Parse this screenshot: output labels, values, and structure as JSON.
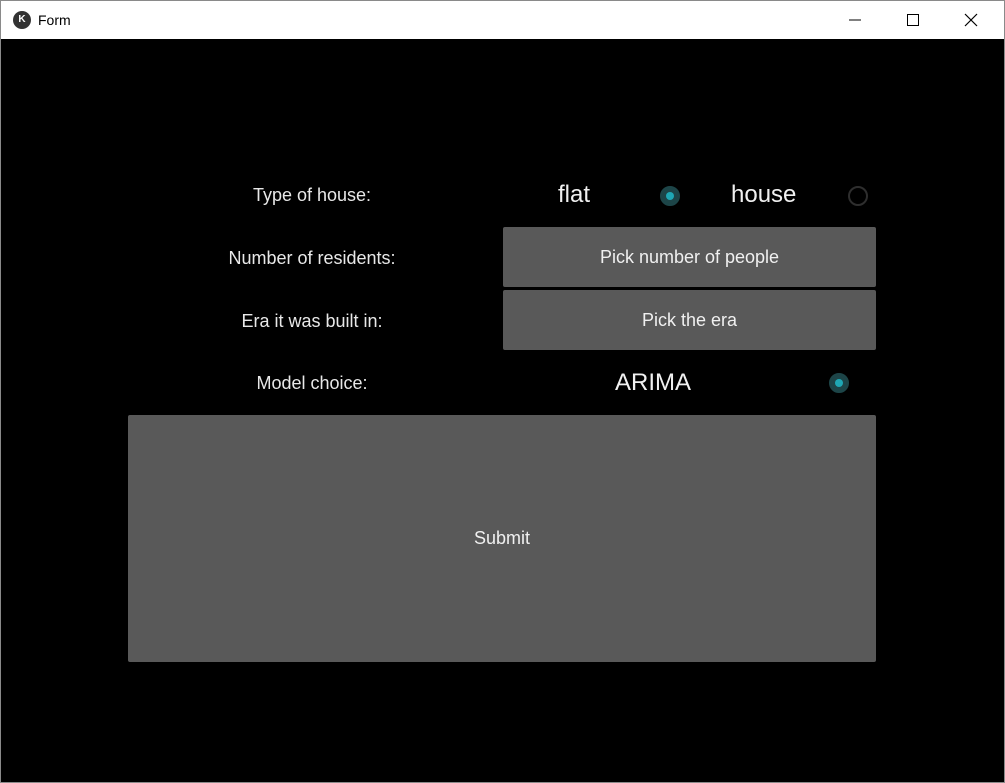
{
  "window": {
    "title": "Form"
  },
  "form": {
    "house_type": {
      "label": "Type of house:",
      "options": [
        {
          "label": "flat",
          "selected": true
        },
        {
          "label": "house",
          "selected": false
        }
      ]
    },
    "residents": {
      "label": "Number of residents:",
      "button": "Pick number of people"
    },
    "era": {
      "label": "Era it was built in:",
      "button": "Pick the era"
    },
    "model": {
      "label": "Model choice:",
      "options": [
        {
          "label": "ARIMA",
          "selected": true
        }
      ]
    },
    "submit": "Submit"
  },
  "colors": {
    "background": "#000000",
    "button": "#595959",
    "radio_accent": "#1fa7b4"
  }
}
